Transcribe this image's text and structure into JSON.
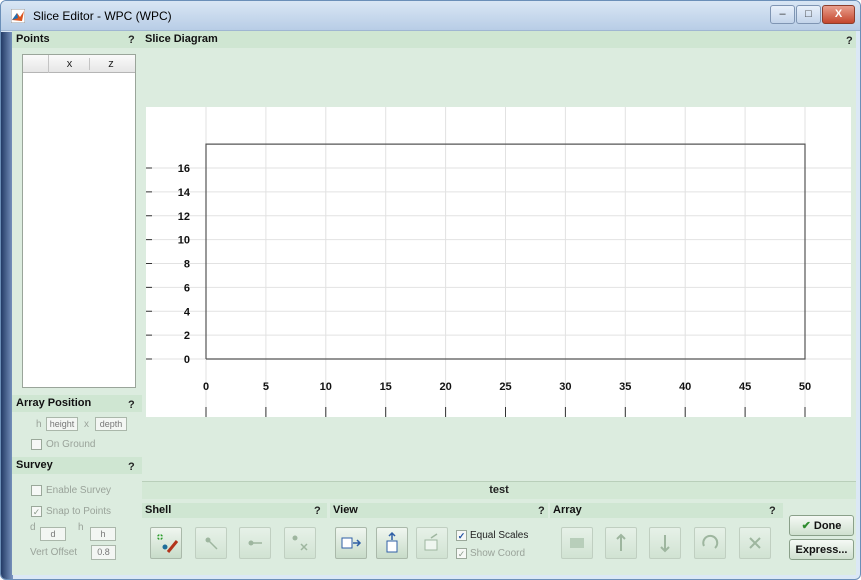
{
  "window": {
    "title": "Slice Editor  - WPC (WPC)",
    "minimize": "–",
    "maximize": "□",
    "close": "X"
  },
  "points": {
    "header": "Points",
    "help": "?",
    "columns": [
      "",
      "x",
      "z"
    ]
  },
  "array_position": {
    "header": "Array Position",
    "help": "?",
    "h_label": "h",
    "height_field": "height",
    "x_label": "x",
    "depth_field": "depth",
    "on_ground_label": "On Ground"
  },
  "survey": {
    "header": "Survey",
    "help": "?",
    "enable_label": "Enable Survey",
    "snap_label": "Snap to Points",
    "d_label": "d",
    "d_value": "d",
    "h_label": "h",
    "h_value": "h",
    "vert_offset_label": "Vert Offset",
    "vert_offset_value": "0.8"
  },
  "slice_diagram": {
    "header": "Slice Diagram",
    "help": "?"
  },
  "chart_data": {
    "type": "line",
    "title": "",
    "xlabel": "",
    "ylabel": "",
    "xlim": [
      -5,
      52
    ],
    "ylim": [
      -1,
      20
    ],
    "x_ticks": [
      0,
      5,
      10,
      15,
      20,
      25,
      30,
      35,
      40,
      45,
      50
    ],
    "y_ticks": [
      0,
      2,
      4,
      6,
      8,
      10,
      12,
      14,
      16
    ],
    "grid": true,
    "series": [
      {
        "x": [
          0,
          50,
          50,
          0,
          0
        ],
        "y": [
          0,
          0,
          18,
          18,
          0
        ]
      }
    ]
  },
  "slice_name": "test",
  "shell": {
    "header": "Shell",
    "help": "?",
    "buttons": [
      "add-point-icon",
      "move-point-icon",
      "insert-point-icon",
      "delete-point-icon"
    ]
  },
  "view": {
    "header": "View",
    "help": "?",
    "buttons": [
      "fit-right-icon",
      "fit-up-icon",
      "pan-icon"
    ],
    "equal_scales_label": "Equal Scales",
    "equal_scales_checked": true,
    "show_coord_label": "Show Coord",
    "show_coord_checked": true
  },
  "array": {
    "header": "Array",
    "help": "?",
    "buttons": [
      "array-add-icon",
      "array-move-up-icon",
      "array-move-down-icon",
      "array-rotate-icon",
      "array-delete-icon"
    ]
  },
  "actions": {
    "done_label": "Done",
    "express_label": "Express..."
  },
  "colors": {
    "panel_bg": "#dcecdf",
    "header_bg": "#cfe6d2",
    "plot_bg": "#ffffff",
    "rect_stroke": "#555555",
    "grid": "#e2e2e2"
  }
}
